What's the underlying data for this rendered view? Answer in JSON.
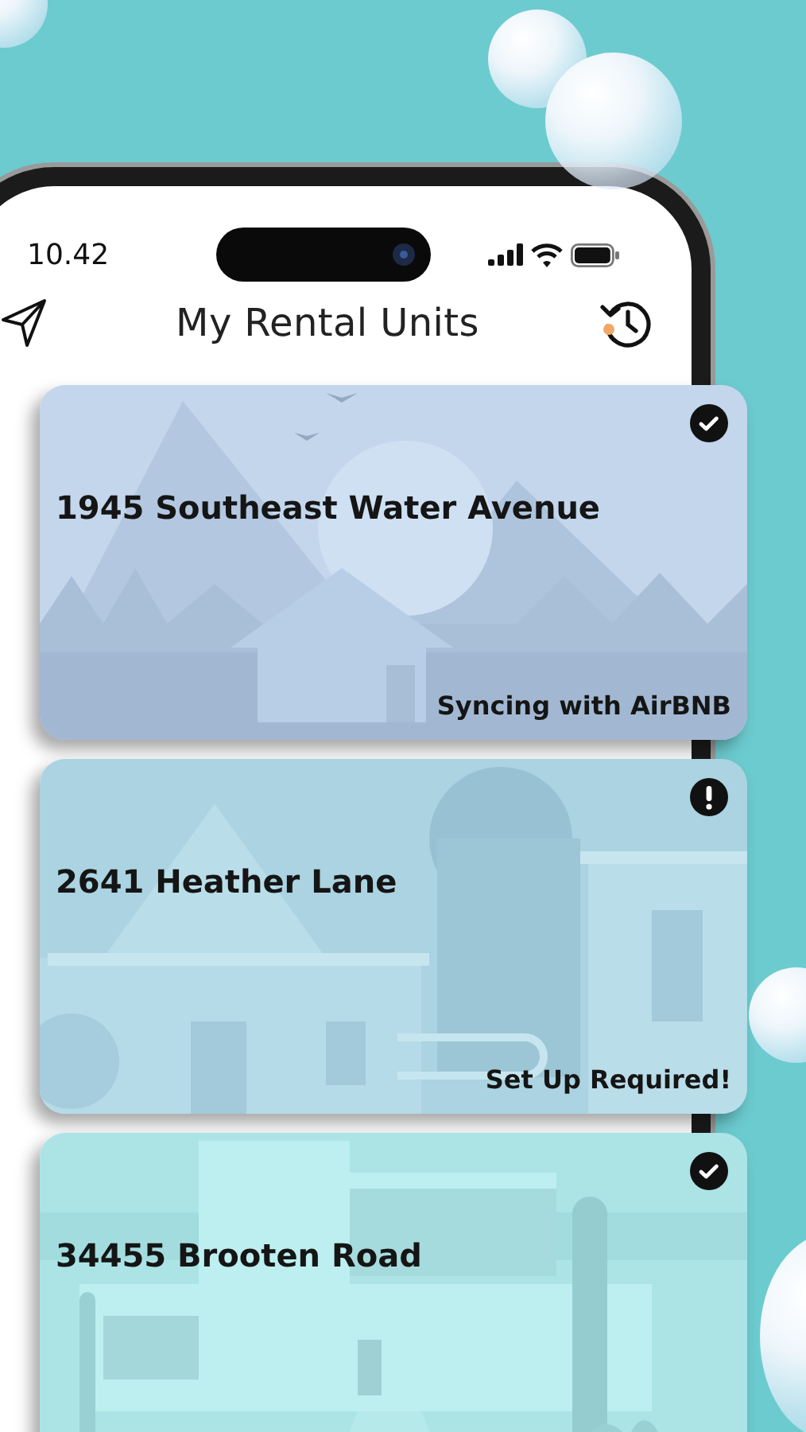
{
  "status_bar": {
    "time": "10.42"
  },
  "header": {
    "title": "My Rental Units"
  },
  "units": [
    {
      "address": "1945 Southeast Water Avenue",
      "alert": false,
      "status": "Syncing with AirBNB"
    },
    {
      "address": "2641 Heather Lane",
      "alert": true,
      "status": "Set Up Required!"
    },
    {
      "address": "34455 Brooten Road",
      "alert": false
    }
  ]
}
